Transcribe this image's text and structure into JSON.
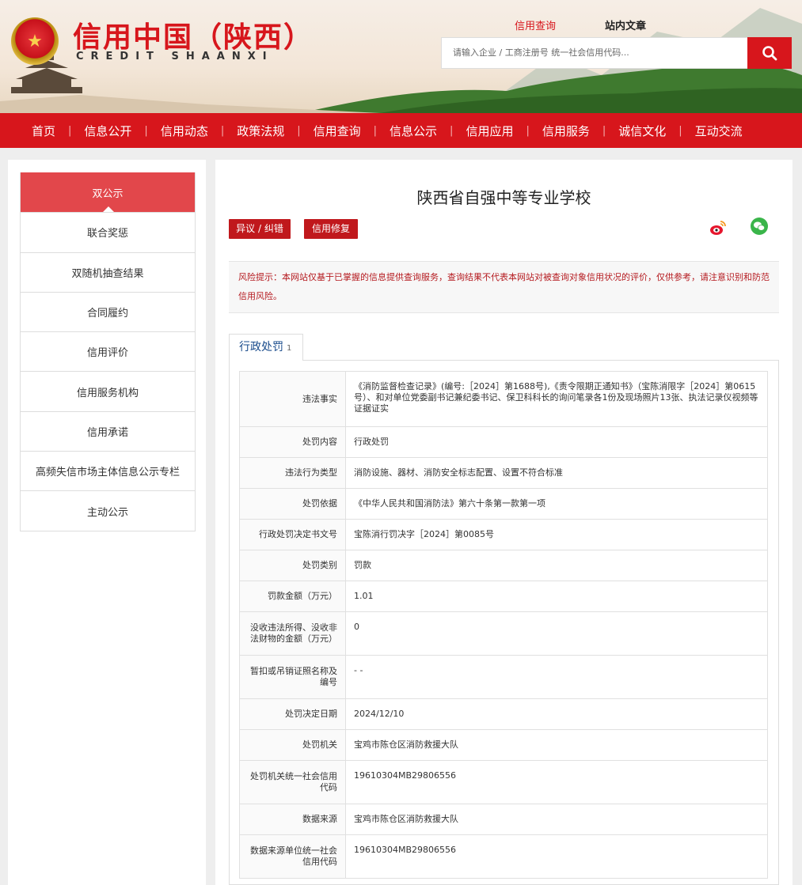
{
  "header": {
    "logo_cn": "信用中国（陕西）",
    "logo_en": "CREDIT    SHAANXI",
    "search_tabs": [
      "信用查询",
      "站内文章"
    ],
    "search_placeholder": "请输入企业 / 工商注册号 统一社会信用代码..."
  },
  "nav": [
    "首页",
    "信息公开",
    "信用动态",
    "政策法规",
    "信用查询",
    "信息公示",
    "信用应用",
    "信用服务",
    "诚信文化",
    "互动交流"
  ],
  "sidebar": [
    "双公示",
    "联合奖惩",
    "双随机抽查结果",
    "合同履约",
    "信用评价",
    "信用服务机构",
    "信用承诺",
    "高频失信市场主体信息公示专栏",
    "主动公示"
  ],
  "main": {
    "title": "陕西省自强中等专业学校",
    "btn_objection": "异议 / 纠错",
    "btn_repair": "信用修复",
    "risk_notice": "风险提示：本网站仅基于已掌握的信息提供查询服务，查询结果不代表本网站对被查询对象信用状况的评价，仅供参考，请注意识别和防范信用风险。",
    "tab_label": "行政处罚",
    "tab_count": "1"
  },
  "records": [
    {
      "k": "违法事实",
      "v": "《消防监督检查记录》(编号:［2024］第1688号),《责令限期正通知书》（宝陈消限字［2024］第0615号）、和对单位党委副书记兼纪委书记、保卫科科长的询问笔录各1份及现场照片13张、执法记录仪视频等证据证实"
    },
    {
      "k": "处罚内容",
      "v": "行政处罚"
    },
    {
      "k": "违法行为类型",
      "v": "消防设施、器材、消防安全标志配置、设置不符合标准"
    },
    {
      "k": "处罚依据",
      "v": "《中华人民共和国消防法》第六十条第一款第一项"
    },
    {
      "k": "行政处罚决定书文号",
      "v": "宝陈消行罚决字［2024］第0085号"
    },
    {
      "k": "处罚类别",
      "v": "罚款"
    },
    {
      "k": "罚款金额（万元）",
      "v": "1.01"
    },
    {
      "k": "没收违法所得、没收非法财物的金额（万元）",
      "v": "0"
    },
    {
      "k": "暂扣或吊销证照名称及编号",
      "v": "- -"
    },
    {
      "k": "处罚决定日期",
      "v": "2024/12/10"
    },
    {
      "k": "处罚机关",
      "v": "宝鸡市陈仓区消防救援大队"
    },
    {
      "k": "处罚机关统一社会信用代码",
      "v": "19610304MB29806556"
    },
    {
      "k": "数据来源",
      "v": "宝鸡市陈仓区消防救援大队"
    },
    {
      "k": "数据来源单位统一社会信用代码",
      "v": "19610304MB29806556"
    }
  ],
  "colors": {
    "brand_red": "#d7161c",
    "active_side": "#e2474b",
    "tab_blue": "#1a4c8c"
  }
}
